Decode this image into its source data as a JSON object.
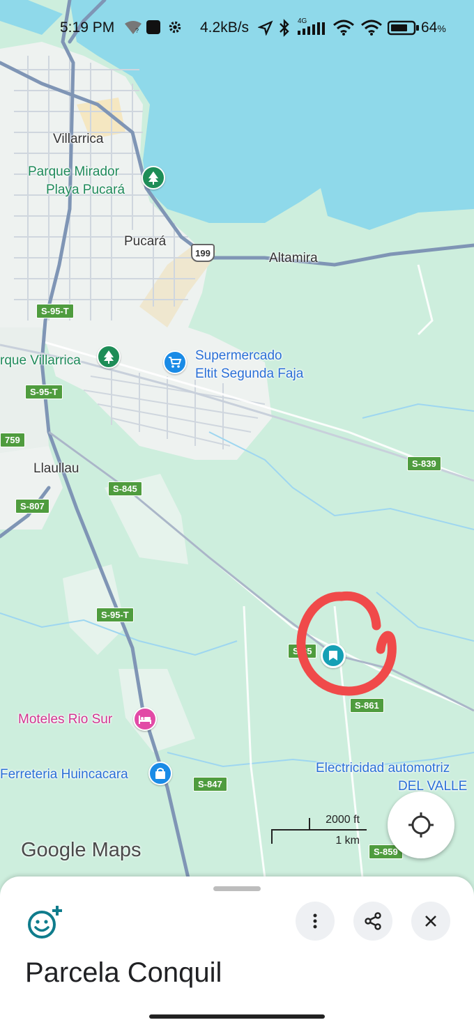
{
  "status_bar": {
    "time": "5:19 PM",
    "speed": "4.2kB/s",
    "network": "4G",
    "battery": "64",
    "icons": [
      "wifi-question-icon",
      "app-square-icon",
      "settings-gear-icon",
      "location-arrow-icon",
      "bluetooth-icon",
      "signal-bars-icon",
      "wifi-icon",
      "wifi-icon",
      "battery-icon"
    ]
  },
  "map": {
    "places": {
      "villarrica": "Villarrica",
      "parque_mirador": "Parque Mirador",
      "playa_pucara": "Playa Pucará",
      "pucara": "Pucará",
      "altamira": "Altamira",
      "parque_villarrica": "rque Villarrica",
      "supermercado_1": "Supermercado",
      "supermercado_2": "Eltit Segunda Faja",
      "llaullau": "Llaullau",
      "moteles": "Moteles Rio Sur",
      "ferreteria": "Ferreteria Huincacara",
      "electricidad_1": "Electricidad automotriz",
      "electricidad_2": "DEL VALLE"
    },
    "roads": {
      "r199": "199",
      "s95t_a": "S-95-T",
      "s95t_b": "S-95-T",
      "s95t_c": "S-95-T",
      "s759": "759",
      "s839": "S-839",
      "s845": "S-845",
      "s807": "S-807",
      "s85": "S-85",
      "s861": "S-861",
      "s847": "S-847",
      "s859": "S-859"
    },
    "scale": {
      "feet": "2000 ft",
      "km": "1 km"
    },
    "logo": "Google Maps",
    "highlight_color": "#f04a4a",
    "water_color": "#8fd9ea",
    "land_color": "#cdeedd"
  },
  "sheet": {
    "title": "Parcela Conquil"
  }
}
